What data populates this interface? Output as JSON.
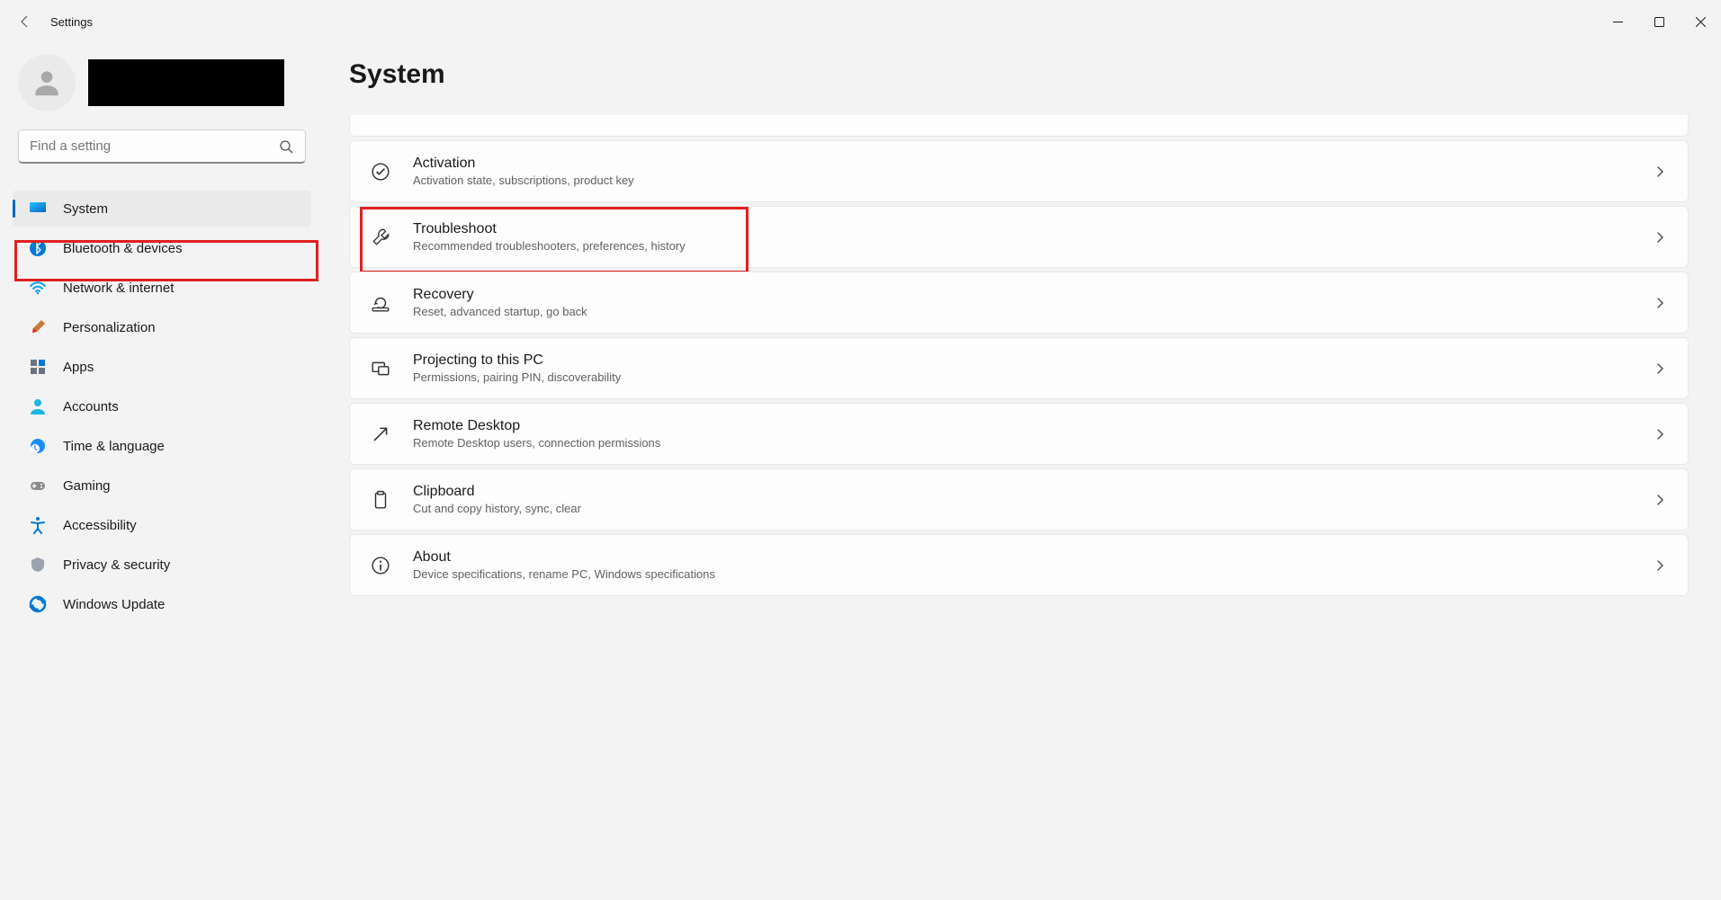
{
  "window": {
    "title": "Settings"
  },
  "search": {
    "placeholder": "Find a setting"
  },
  "nav": {
    "items": [
      {
        "label": "System",
        "icon": "display-icon",
        "active": true
      },
      {
        "label": "Bluetooth & devices",
        "icon": "bluetooth-icon"
      },
      {
        "label": "Network & internet",
        "icon": "wifi-icon"
      },
      {
        "label": "Personalization",
        "icon": "brush-icon"
      },
      {
        "label": "Apps",
        "icon": "apps-icon"
      },
      {
        "label": "Accounts",
        "icon": "person-icon"
      },
      {
        "label": "Time & language",
        "icon": "clock-globe-icon"
      },
      {
        "label": "Gaming",
        "icon": "gamepad-icon"
      },
      {
        "label": "Accessibility",
        "icon": "accessibility-icon"
      },
      {
        "label": "Privacy & security",
        "icon": "shield-icon"
      },
      {
        "label": "Windows Update",
        "icon": "update-icon"
      }
    ]
  },
  "page": {
    "title": "System"
  },
  "cards": [
    {
      "title": "Activation",
      "desc": "Activation state, subscriptions, product key",
      "icon": "check-circle-icon"
    },
    {
      "title": "Troubleshoot",
      "desc": "Recommended troubleshooters, preferences, history",
      "icon": "wrench-icon",
      "highlighted": true
    },
    {
      "title": "Recovery",
      "desc": "Reset, advanced startup, go back",
      "icon": "recovery-icon"
    },
    {
      "title": "Projecting to this PC",
      "desc": "Permissions, pairing PIN, discoverability",
      "icon": "project-icon"
    },
    {
      "title": "Remote Desktop",
      "desc": "Remote Desktop users, connection permissions",
      "icon": "remote-icon"
    },
    {
      "title": "Clipboard",
      "desc": "Cut and copy history, sync, clear",
      "icon": "clipboard-icon"
    },
    {
      "title": "About",
      "desc": "Device specifications, rename PC, Windows specifications",
      "icon": "info-icon"
    }
  ]
}
